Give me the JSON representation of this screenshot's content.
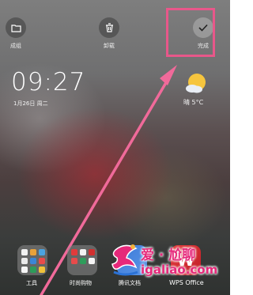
{
  "actions": {
    "dissolve_label": "成组",
    "uninstall_label": "卸载",
    "done_label": "完成"
  },
  "lockscreen": {
    "time": "09:27",
    "date": "1月26日 周二"
  },
  "weather": {
    "icon": "partly-sunny-icon",
    "condition": "晴",
    "temperature": "5°C"
  },
  "dock": {
    "tools_label": "工具",
    "shopping_label": "时尚购物",
    "docs_label": "腾讯文档",
    "wps_label": "WPS Office"
  },
  "watermark": {
    "brand": "爱 · 尬聊",
    "domain": "igaliao.com"
  },
  "colors": {
    "highlight": "#e8578a",
    "arrow": "#f06a9a",
    "watermark": "#e6287a"
  }
}
